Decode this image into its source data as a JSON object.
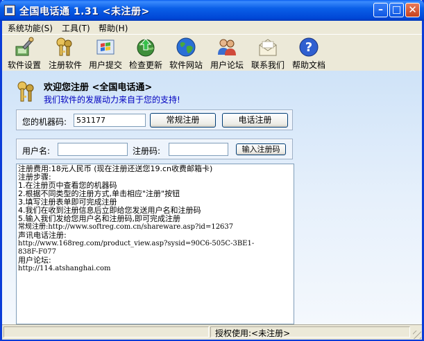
{
  "window": {
    "title": "全国电话通 1.31 <未注册>"
  },
  "menu": [
    {
      "label": "系统功能(S)"
    },
    {
      "label": "工具(T)"
    },
    {
      "label": "帮助(H)"
    }
  ],
  "toolbar": [
    {
      "label": "软件设置",
      "icon": "settings-icon"
    },
    {
      "label": "注册软件",
      "icon": "keys-icon"
    },
    {
      "label": "用户提交",
      "icon": "windows-icon"
    },
    {
      "label": "检查更新",
      "icon": "update-globe-icon"
    },
    {
      "label": "软件网站",
      "icon": "globe-icon"
    },
    {
      "label": "用户论坛",
      "icon": "users-icon"
    },
    {
      "label": "联系我们",
      "icon": "envelope-icon"
    },
    {
      "label": "帮助文档",
      "icon": "help-icon"
    }
  ],
  "register": {
    "welcome": "欢迎您注册 <全国电话通>",
    "slogan": "我们软件的发展动力来自于您的支持!",
    "machine_label": "您的机器码:",
    "machine_code": "531177",
    "normal_register": "常规注册",
    "phone_register": "电话注册",
    "username_label": "用户名:",
    "username_value": "",
    "code_label": "注册码:",
    "code_value": "",
    "submit_label": "输入注册码"
  },
  "info_lines": [
    "注册费用:18元人民币 (现在注册还送您19.cn收费邮箱卡)",
    "",
    "注册步骤:",
    "1.在注册页中查看您的机器码",
    "2.根据不同类型的注册方式,单击相应\"注册\"按钮",
    "3.填写注册表单即可完成注册",
    "4.我们在收到注册信息后立即给您发送用户名和注册码",
    "5.输入我们发给您用户名和注册码,即可完成注册",
    "",
    "常规注册:http://www.softreg.com.cn/shareware.asp?id=12637",
    "",
    "声讯电话注册:",
    "http://www.168reg.com/product_view.asp?sysid=90C6-505C-3BE1-",
    "838F-F077",
    "",
    "用户论坛:",
    "",
    "http://114.atshanghai.com"
  ],
  "status": {
    "text": "授权使用:<未注册>"
  }
}
